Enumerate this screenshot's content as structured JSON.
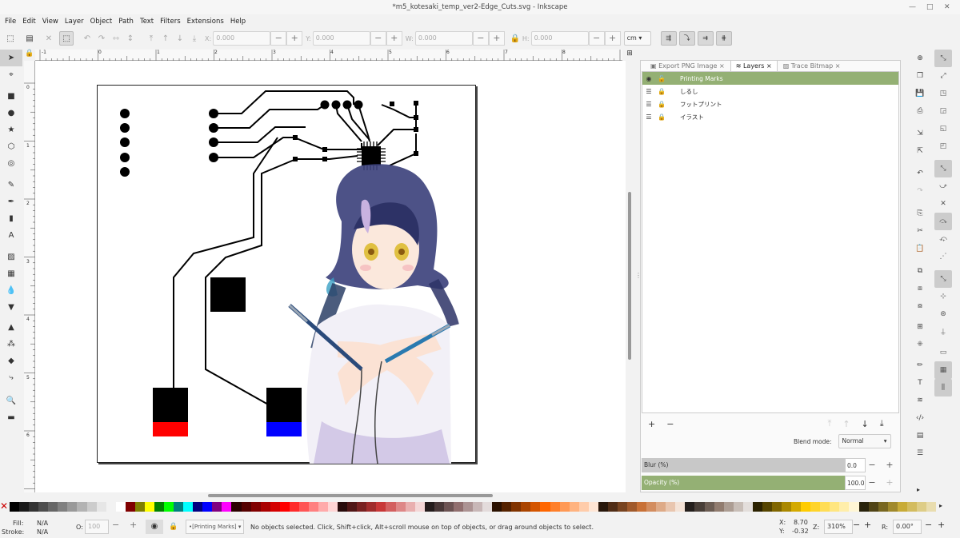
{
  "window": {
    "title": "*m5_kotesaki_temp_ver2-Edge_Cuts.svg - Inkscape"
  },
  "menu": [
    "File",
    "Edit",
    "View",
    "Layer",
    "Object",
    "Path",
    "Text",
    "Filters",
    "Extensions",
    "Help"
  ],
  "toolbar": {
    "x_label": "X:",
    "x_value": "0.000",
    "y_label": "Y:",
    "y_value": "0.000",
    "w_label": "W:",
    "w_value": "0.000",
    "h_label": "H:",
    "h_value": "0.000",
    "unit": "cm",
    "minus": "−",
    "plus": "+"
  },
  "ruler": {
    "h_ticks": [
      "-1",
      "0",
      "1",
      "2",
      "3",
      "4",
      "5",
      "6",
      "7",
      "8"
    ],
    "v_ticks": [
      "0",
      "1",
      "2",
      "3",
      "4",
      "5",
      "6"
    ]
  },
  "panel": {
    "tabs": [
      {
        "label": "Export PNG Image",
        "close": "×"
      },
      {
        "label": "Layers",
        "close": "×"
      },
      {
        "label": "Trace Bitmap",
        "close": "×"
      }
    ],
    "layers": [
      {
        "name": "Printing Marks",
        "selected": true
      },
      {
        "name": "しるし",
        "selected": false
      },
      {
        "name": "フットプリント",
        "selected": false
      },
      {
        "name": "イラスト",
        "selected": false
      }
    ],
    "add": "+",
    "remove": "−",
    "blend_label": "Blend mode:",
    "blend_value": "Normal",
    "blur_label": "Blur (%)",
    "blur_value": "0.0",
    "opacity_label": "Opacity (%)",
    "opacity_value": "100.0"
  },
  "status": {
    "fill_label": "Fill:",
    "fill_value": "N/A",
    "stroke_label": "Stroke:",
    "stroke_value": "N/A",
    "o_label": "O:",
    "o_value": "100",
    "layer": "•[Printing Marks]",
    "message": "No objects selected. Click, Shift+click, Alt+scroll mouse on top of objects, or drag around objects to select.",
    "x_label": "X:",
    "x_value": "8.70",
    "y_label": "Y:",
    "y_value": "-0.32",
    "z_label": "Z:",
    "zoom": "310%",
    "r_label": "R:",
    "rotation": "0.00°"
  },
  "colors": {
    "layer_selected": "#94b074",
    "pad_red": "#ff0000",
    "pad_blue": "#0000ff"
  },
  "palette": [
    "#000000",
    "#1a1a1a",
    "#333333",
    "#4d4d4d",
    "#666666",
    "#808080",
    "#999999",
    "#b3b3b3",
    "#cccccc",
    "#e6e6e6",
    "#f2f2f2",
    "#ffffff",
    "#800000",
    "#808000",
    "#ffff00",
    "#008000",
    "#00ff00",
    "#008080",
    "#00ffff",
    "#000080",
    "#0000ff",
    "#800080",
    "#ff00ff",
    "#2b0000",
    "#550000",
    "#800000",
    "#aa0000",
    "#d40000",
    "#ff0000",
    "#ff2a2a",
    "#ff5555",
    "#ff8080",
    "#ffaaaa",
    "#ffd5d5",
    "#280b0b",
    "#501616",
    "#782121",
    "#a02c2c",
    "#c83737",
    "#d35f5f",
    "#de8787",
    "#e9afaf",
    "#f4d7d7",
    "#241c1c",
    "#483737",
    "#6c5353",
    "#916f6f",
    "#ac9393",
    "#c8b7b7",
    "#e3dbdb",
    "#2b1100",
    "#552200",
    "#803300",
    "#aa4400",
    "#d45500",
    "#ff6600",
    "#ff7f2a",
    "#ff9955",
    "#ffb380",
    "#ffccaa",
    "#ffe6d5",
    "#28170b",
    "#502d16",
    "#784421",
    "#a05a2c",
    "#c87137",
    "#d38d5f",
    "#deaa87",
    "#e9c6af",
    "#f4e3d7",
    "#241f1c",
    "#483e37",
    "#6c5d53",
    "#917c6f",
    "#ac9d93",
    "#c8beb7",
    "#e3dedb",
    "#2b2200",
    "#554400",
    "#806600",
    "#aa8800",
    "#d4aa00",
    "#ffcc00",
    "#ffd42a",
    "#ffdd55",
    "#ffe680",
    "#ffeeaa",
    "#fff6d5",
    "#28220b",
    "#504416",
    "#786721",
    "#a0892c",
    "#c8ab37",
    "#d3bc5f",
    "#decd87",
    "#e9ddaf"
  ]
}
